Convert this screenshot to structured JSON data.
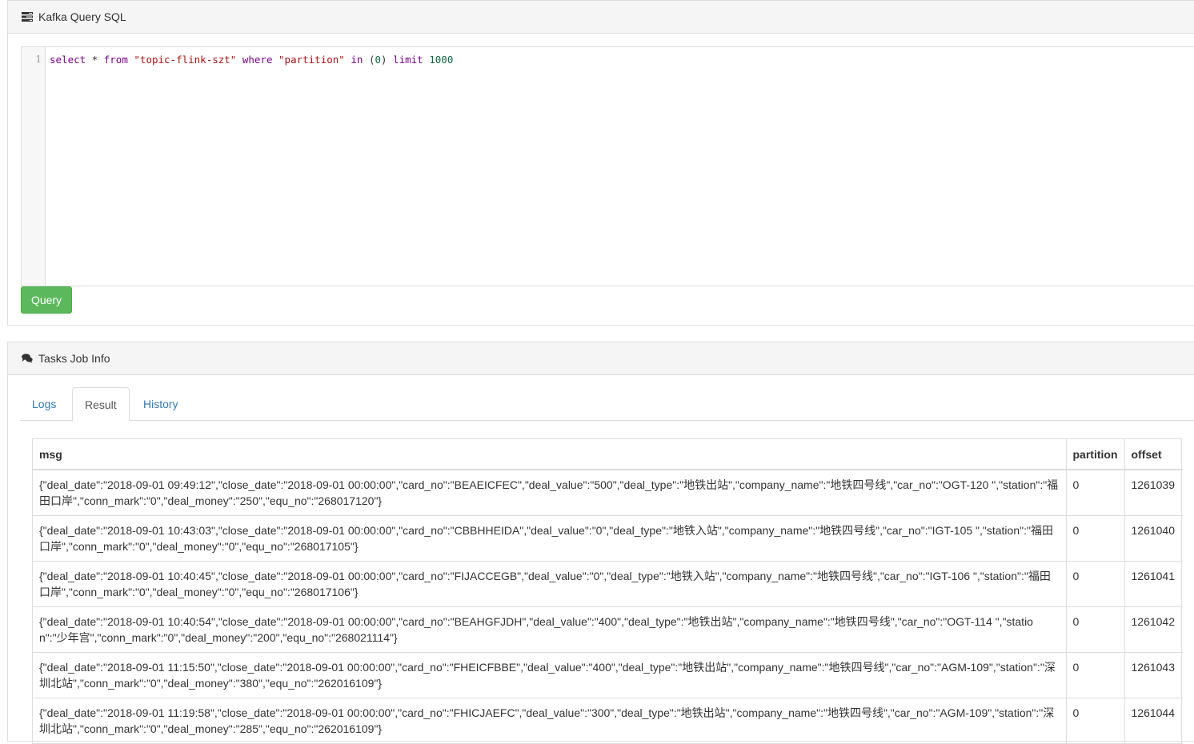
{
  "sql_panel": {
    "title": "Kafka Query SQL",
    "line_number": "1",
    "query_tokens": {
      "select": "select",
      "star": "*",
      "from": "from",
      "topic": "\"topic-flink-szt\"",
      "where": "where",
      "column": "\"partition\"",
      "in": "in",
      "paren_open": "(",
      "value": "0",
      "paren_close": ")",
      "limit": "limit",
      "limit_value": "1000"
    },
    "query_button": "Query"
  },
  "tasks_panel": {
    "title": "Tasks Job Info",
    "tabs": [
      {
        "label": "Logs"
      },
      {
        "label": "Result"
      },
      {
        "label": "History"
      }
    ],
    "active_tab": "Result",
    "table": {
      "columns": [
        "msg",
        "partition",
        "offset"
      ],
      "rows": [
        {
          "msg": "{\"deal_date\":\"2018-09-01 09:49:12\",\"close_date\":\"2018-09-01 00:00:00\",\"card_no\":\"BEAEICFEC\",\"deal_value\":\"500\",\"deal_type\":\"地铁出站\",\"company_name\":\"地铁四号线\",\"car_no\":\"OGT-120 \",\"station\":\"福田口岸\",\"conn_mark\":\"0\",\"deal_money\":\"250\",\"equ_no\":\"268017120\"}",
          "partition": "0",
          "offset": "1261039"
        },
        {
          "msg": "{\"deal_date\":\"2018-09-01 10:43:03\",\"close_date\":\"2018-09-01 00:00:00\",\"card_no\":\"CBBHHEIDA\",\"deal_value\":\"0\",\"deal_type\":\"地铁入站\",\"company_name\":\"地铁四号线\",\"car_no\":\"IGT-105 \",\"station\":\"福田口岸\",\"conn_mark\":\"0\",\"deal_money\":\"0\",\"equ_no\":\"268017105\"}",
          "partition": "0",
          "offset": "1261040"
        },
        {
          "msg": "{\"deal_date\":\"2018-09-01 10:40:45\",\"close_date\":\"2018-09-01 00:00:00\",\"card_no\":\"FIJACCEGB\",\"deal_value\":\"0\",\"deal_type\":\"地铁入站\",\"company_name\":\"地铁四号线\",\"car_no\":\"IGT-106 \",\"station\":\"福田口岸\",\"conn_mark\":\"0\",\"deal_money\":\"0\",\"equ_no\":\"268017106\"}",
          "partition": "0",
          "offset": "1261041"
        },
        {
          "msg": "{\"deal_date\":\"2018-09-01 10:40:54\",\"close_date\":\"2018-09-01 00:00:00\",\"card_no\":\"BEAHGFJDH\",\"deal_value\":\"400\",\"deal_type\":\"地铁出站\",\"company_name\":\"地铁四号线\",\"car_no\":\"OGT-114 \",\"station\":\"少年宫\",\"conn_mark\":\"0\",\"deal_money\":\"200\",\"equ_no\":\"268021114\"}",
          "partition": "0",
          "offset": "1261042"
        },
        {
          "msg": "{\"deal_date\":\"2018-09-01 11:15:50\",\"close_date\":\"2018-09-01 00:00:00\",\"card_no\":\"FHEICFBBE\",\"deal_value\":\"400\",\"deal_type\":\"地铁出站\",\"company_name\":\"地铁四号线\",\"car_no\":\"AGM-109\",\"station\":\"深圳北站\",\"conn_mark\":\"0\",\"deal_money\":\"380\",\"equ_no\":\"262016109\"}",
          "partition": "0",
          "offset": "1261043"
        },
        {
          "msg": "{\"deal_date\":\"2018-09-01 11:19:58\",\"close_date\":\"2018-09-01 00:00:00\",\"card_no\":\"FHICJAEFC\",\"deal_value\":\"300\",\"deal_type\":\"地铁出站\",\"company_name\":\"地铁四号线\",\"car_no\":\"AGM-109\",\"station\":\"深圳北站\",\"conn_mark\":\"0\",\"deal_money\":\"285\",\"equ_no\":\"262016109\"}",
          "partition": "0",
          "offset": "1261044"
        }
      ]
    }
  },
  "colors": {
    "query_button": "#5cb85c",
    "link": "#337ab7"
  },
  "icons": {
    "sql_panel": "tasks-list-icon",
    "tasks_panel": "comments-icon"
  }
}
